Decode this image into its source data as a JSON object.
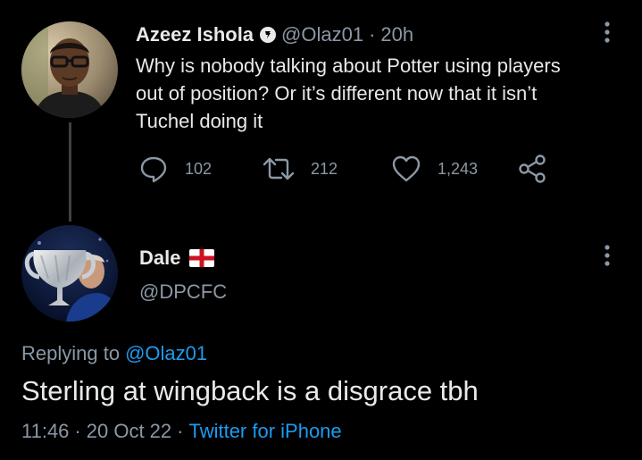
{
  "tweet": {
    "author_name": "Azeez Ishola",
    "author_handle": "@Olaz01",
    "separator": "·",
    "time": "20h",
    "text": "Why is nobody talking about Potter using players\nout of position? Or it’s different now that it isn’t\nTuchel doing it",
    "stats": {
      "replies": "102",
      "retweets": "212",
      "likes": "1,243"
    },
    "icons": {
      "badge": "verified-badge-icon",
      "more": "more-vertical-icon",
      "reply": "reply-icon",
      "retweet": "retweet-icon",
      "like": "heart-icon",
      "share": "share-icon"
    }
  },
  "reply": {
    "author_name": "Dale",
    "author_flag": "england-flag-icon",
    "author_handle": "@DPCFC",
    "replying_prefix": "Replying to",
    "replying_to": "@Olaz01",
    "text": "Sterling at wingback is a disgrace tbh",
    "time": "11:46",
    "date": "20 Oct 22",
    "separator": "·",
    "source": "Twitter for iPhone"
  },
  "colors": {
    "background": "#000000",
    "text_primary": "#e7e9ea",
    "text_secondary": "#8b98a5",
    "link": "#1d9bf0",
    "thread_line": "#3e4144"
  }
}
